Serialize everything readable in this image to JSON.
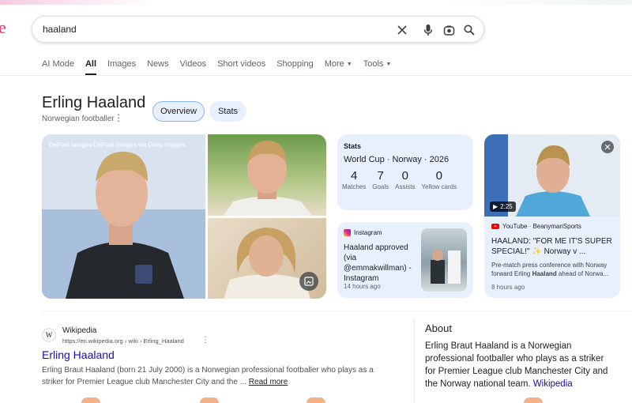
{
  "search": {
    "query": "haaland",
    "logo_fragment": "e"
  },
  "tabs": [
    {
      "label": "AI Mode",
      "active": false
    },
    {
      "label": "All",
      "active": true
    },
    {
      "label": "Images",
      "active": false
    },
    {
      "label": "News",
      "active": false
    },
    {
      "label": "Videos",
      "active": false
    },
    {
      "label": "Short videos",
      "active": false
    },
    {
      "label": "Shopping",
      "active": false
    },
    {
      "label": "More",
      "active": false,
      "dropdown": true
    },
    {
      "label": "Tools",
      "active": false,
      "dropdown": true
    }
  ],
  "entity": {
    "title": "Erling Haaland",
    "subtitle": "Norwegian footballer",
    "chips": [
      "Overview",
      "Stats"
    ]
  },
  "images": {
    "credit": "DeFodi Images/DeFodi Images via Getty Images"
  },
  "stats_card": {
    "label": "Stats",
    "subtitle": "World Cup · Norway · 2026",
    "items": [
      {
        "value": "4",
        "caption": "Matches"
      },
      {
        "value": "7",
        "caption": "Goals"
      },
      {
        "value": "0",
        "caption": "Assists"
      },
      {
        "value": "0",
        "caption": "Yellow cards"
      }
    ]
  },
  "instagram_card": {
    "source": "Instagram",
    "text": "Haaland approved (via @emmakwillman) - Instagram",
    "time": "14 hours ago"
  },
  "youtube_card": {
    "duration": "2:25",
    "source": "YouTube · BeanymanSports",
    "title": "HAALAND: \"FOR ME IT'S SUPER SPECIAL!\" ✨ Norway v ...",
    "desc_before": "Pre-match press conference with Norway forward Erling ",
    "desc_bold": "Haaland",
    "desc_after": " ahead of Norwa...",
    "time": "8 hours ago"
  },
  "wiki_result": {
    "favicon": "W",
    "site": "Wikipedia",
    "url": "https://en.wikipedia.org › wiki › Erling_Haaland",
    "title": "Erling Haaland",
    "snippet": "Erling Braut Haaland (born 21 July 2000) is a Norwegian professional footballer who plays as a striker for Premier League club Manchester City and the ... ",
    "read_more": "Read more"
  },
  "about": {
    "heading": "About",
    "text": "Erling Braut Haaland is a Norwegian professional footballer who plays as a striker for Premier League club Manchester City and the Norway national team. ",
    "link": "Wikipedia"
  },
  "colors": {
    "link": "#1a0dab",
    "card_bg": "#e8f0fe",
    "chip_border": "#8ab4f8"
  }
}
